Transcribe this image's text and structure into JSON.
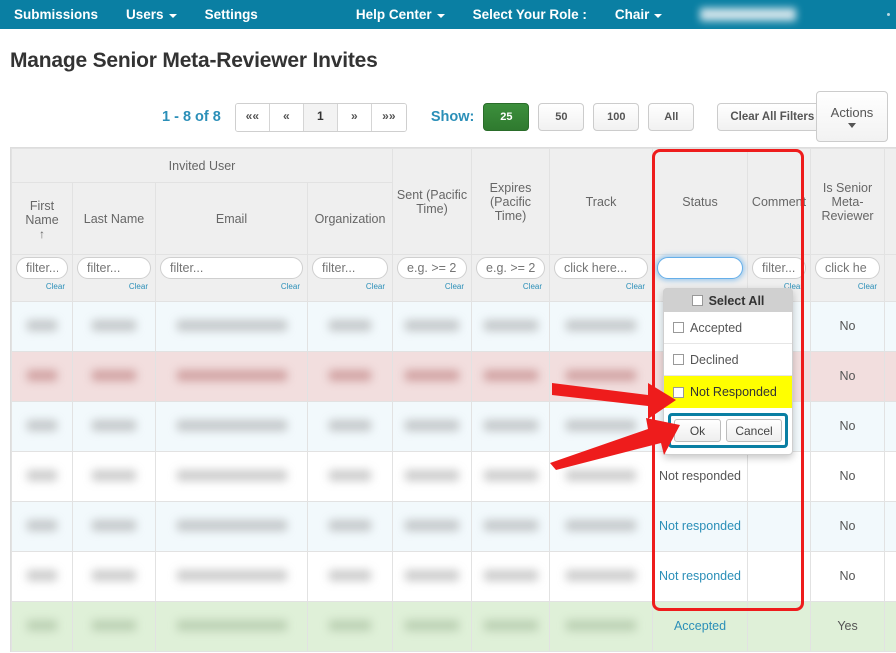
{
  "navbar": {
    "bg": "#0a7fa3",
    "left_items": [
      {
        "label": "Submissions",
        "caret": false
      },
      {
        "label": "Users",
        "caret": true
      },
      {
        "label": "Settings",
        "caret": false
      }
    ],
    "help_center": "Help Center",
    "role_label": "Select Your Role :",
    "role_value": "Chair"
  },
  "page": {
    "title": "Manage Senior Meta-Reviewer Invites"
  },
  "toolbar": {
    "count_prefix": "1",
    "count_dash": "-",
    "count_suffix": "8 of 8",
    "count_text": "1 - 8 of 8",
    "pager": [
      "««",
      "«",
      "1",
      "»",
      "»»"
    ],
    "pager_active_index": 2,
    "show_label": "Show:",
    "page_sizes": [
      "25",
      "50",
      "100",
      "All"
    ],
    "page_size_selected": "25",
    "clear_all_filters": "Clear All Filters",
    "actions": "Actions"
  },
  "table": {
    "group_header": "Invited User",
    "columns": [
      {
        "key": "first_name",
        "label": "First Name",
        "sorted": true,
        "sort_arrow": "↑"
      },
      {
        "key": "last_name",
        "label": "Last Name"
      },
      {
        "key": "email",
        "label": "Email"
      },
      {
        "key": "organization",
        "label": "Organization"
      },
      {
        "key": "sent",
        "label": "Sent (Pacific Time)"
      },
      {
        "key": "expires",
        "label": "Expires (Pacific Time)"
      },
      {
        "key": "track",
        "label": "Track"
      },
      {
        "key": "status",
        "label": "Status"
      },
      {
        "key": "comment",
        "label": "Comment"
      },
      {
        "key": "is_senior",
        "label": "Is Senior Meta-Reviewer"
      }
    ],
    "filters": [
      {
        "key": "first_name",
        "placeholder": "filter...",
        "value": "",
        "clear": "Clear",
        "focused": false
      },
      {
        "key": "last_name",
        "placeholder": "filter...",
        "value": "",
        "clear": "Clear",
        "focused": false
      },
      {
        "key": "email",
        "placeholder": "filter...",
        "value": "",
        "clear": "Clear",
        "focused": false
      },
      {
        "key": "organization",
        "placeholder": "filter...",
        "value": "",
        "clear": "Clear",
        "focused": false
      },
      {
        "key": "sent",
        "placeholder": "e.g. >= 2",
        "value": "",
        "clear": "Clear",
        "focused": false
      },
      {
        "key": "expires",
        "placeholder": "e.g. >= 2",
        "value": "",
        "clear": "Clear",
        "focused": false
      },
      {
        "key": "track",
        "placeholder": "click here...",
        "value": "",
        "clear": "Clear",
        "focused": false
      },
      {
        "key": "status",
        "placeholder": "",
        "value": "",
        "clear": "",
        "focused": true
      },
      {
        "key": "comment",
        "placeholder": "filter...",
        "value": "",
        "clear": "Clear",
        "focused": false
      },
      {
        "key": "is_senior",
        "placeholder": "click he",
        "value": "",
        "clear": "Clear",
        "focused": false
      }
    ],
    "rows": [
      {
        "style": "r-blue",
        "redacted": true,
        "status": "",
        "comment": "",
        "is_senior": "No"
      },
      {
        "style": "r-pink",
        "redacted": true,
        "status": "",
        "comment": "",
        "is_senior": "No"
      },
      {
        "style": "r-blue",
        "redacted": true,
        "status": "",
        "comment": "",
        "is_senior": "No"
      },
      {
        "style": "r-white",
        "redacted": true,
        "status": "Not responded",
        "status_color": "#555555",
        "comment": "",
        "is_senior": "No"
      },
      {
        "style": "r-blue",
        "redacted": true,
        "status": "Not responded",
        "status_color": "#2b8fb8",
        "comment": "",
        "is_senior": "No"
      },
      {
        "style": "r-white",
        "redacted": true,
        "status": "Not responded",
        "status_color": "#2b8fb8",
        "comment": "",
        "is_senior": "No"
      },
      {
        "style": "r-green",
        "redacted": true,
        "status": "Accepted",
        "status_color": "#2b8fb8",
        "comment": "",
        "is_senior": "Yes"
      }
    ]
  },
  "status_dropdown": {
    "select_all": "Select All",
    "options": [
      {
        "label": "Accepted",
        "checked": false,
        "highlighted": false
      },
      {
        "label": "Declined",
        "checked": false,
        "highlighted": false
      },
      {
        "label": "Not Responded",
        "checked": false,
        "highlighted": true
      }
    ],
    "ok": "Ok",
    "cancel": "Cancel",
    "highlight_color": "#ffff00",
    "button_outline_color": "#0a7fa3"
  },
  "annotations": {
    "rect_color": "#ee1c1c",
    "arrow_color": "#ee1c1c",
    "arrow_count": 2
  }
}
